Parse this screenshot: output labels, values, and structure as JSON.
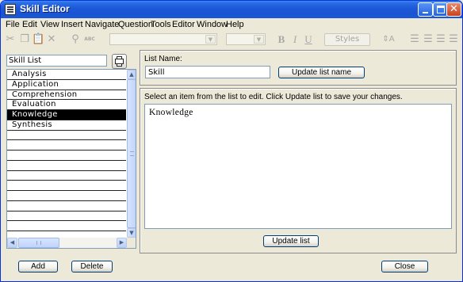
{
  "window": {
    "title": "Skill Editor",
    "controls": {
      "minimize": "minimize",
      "maximize": "maximize",
      "close": "✕"
    }
  },
  "menu": [
    "File",
    "Edit",
    "View",
    "Insert",
    "Navigate",
    "Question",
    "Tools",
    "Editor",
    "Window",
    "Help"
  ],
  "toolbar": {
    "styles_label": "Styles",
    "bold": "B",
    "italic": "I",
    "underline": "U",
    "font_size_icon": "⇕A",
    "spell_label": "ABC"
  },
  "left": {
    "skill_list_value": "Skill List",
    "items": [
      "Analysis",
      "Application",
      "Comprehension",
      "Evaluation",
      "Knowledge",
      "Synthesis",
      "",
      "",
      "",
      "",
      "",
      "",
      "",
      "",
      "",
      "",
      ""
    ],
    "selected_index": 4
  },
  "right": {
    "list_name_label": "List Name:",
    "list_name_value": "Skill",
    "update_list_name_button": "Update list name",
    "instructions": "Select an item from the list to edit. Click Update list to save your changes.",
    "editor_text": "Knowledge",
    "update_list_button": "Update list"
  },
  "footer": {
    "add_button": "Add",
    "delete_button": "Delete",
    "close_button": "Close"
  },
  "colors": {
    "titlebar": "#1D5AD8",
    "window_bg": "#ECE9D8",
    "selection": "#000000",
    "input_border": "#7F9DB9"
  }
}
